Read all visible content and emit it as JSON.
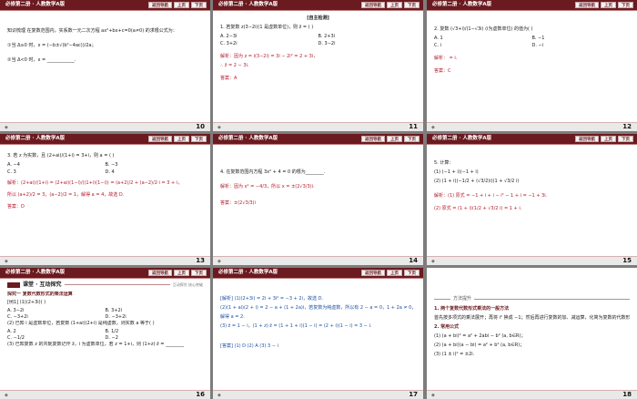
{
  "header": {
    "title": "必修第二册 · 人教数学A版",
    "nav_label": "返回导航",
    "prev_label": "上页",
    "next_label": "下页"
  },
  "slides": [
    {
      "page": "10",
      "lines": [
        "知识梳理 在复数范围内，实系数一元二次方程 ax²+bx+c=0(a≠0) 的求根公式为：",
        "①当 Δ≥0 时，x = (−b±√(b²−4ac))/2a；",
        "②当 Δ<0 时，x = ____________."
      ]
    },
    {
      "page": "11",
      "section": "[自主检测]",
      "lines": [
        "1. 若复数 z(3−2i)(1 是虚数单位)，则 z̄ = (  )",
        "解析：因为 z = i(3−2i) = 3i − 2i² = 2 + 3i，",
        "∴ z̄ = 2 − 3i.",
        "答案：A"
      ],
      "options": [
        "A. 2−3i",
        "B. 2+3i",
        "C. 3+2i",
        "D. 3−2i"
      ]
    },
    {
      "page": "12",
      "lines": [
        "2. 复数 (√3+i)/(1−√3i) (i为虚数单位) 的值为(  )",
        "解析： = i.",
        "答案：C"
      ],
      "options": [
        "A. 1",
        "B. −1",
        "C. i",
        "D. −i"
      ]
    },
    {
      "page": "13",
      "lines": [
        "3. 若 z 为实数，且 (2+ai)/(1+i) = 3+i，则 a = (  )",
        "解析：(2+ai)/(1+i) = (2+ai)(1−i)/((1+i)(1−i)) = (a+2)/2 + (a−2)/2·i = 3 + i，",
        "所以 (a+2)/2 = 3，(a−2)/2 = 1，解得 a = 4，故选 D.",
        "答案：D"
      ],
      "options": [
        "A. −4",
        "B. −3",
        "C. 3",
        "D. 4"
      ]
    },
    {
      "page": "14",
      "lines": [
        "4. 在复数范围内方程 3x² + 4 = 0 的根为________.",
        "解析：因为 x² = −4/3，所以 x = ±(2√3/3)i.",
        "答案：±(2√3/3)i"
      ]
    },
    {
      "page": "15",
      "lines": [
        "5. 计算：",
        "(1) (−1 + i)(−1 + i)",
        "(2) (1 + i)(−1/2 + (√3/2)i)(1 + √3/2 i)",
        "解析：(1) 原式 = −1 + i + i − i² − 1 + i = −1 + 3i.",
        "(2) 原式 = (1 + i)(1/2 + √3/2 i) = 1 + i."
      ]
    },
    {
      "page": "16",
      "banner": "课堂 · 互动探究",
      "banner_tag": "互动探究  核心突破",
      "lines": [
        "探究一  复数代数形式的乘法运算",
        "[例1]  (1)(2+3i)(  )",
        "(2) 已知 i 是虚数单位，若复数 (1+ai)(2+i) 是纯虚数，则实数 a 等于(  )",
        "(3) 已知复数 z 的共轭复数记作 z̄，i 为虚数单位，若 z = 1+i，则 (1+z)·z̄ = ________"
      ],
      "options": [
        "A. 3−2i",
        "B. 3+2i",
        "C. −3+2i",
        "D. −3+2i",
        "A. 2",
        "B. 1/2",
        "C. −1/2",
        "D. −2"
      ]
    },
    {
      "page": "17",
      "lines": [
        "[解析]  (1)(2+3i) = 2i + 3i² = −3 + 2i，故选 D.",
        "(2)(1 + ai)(2 + i) = 2 − a + (1 + 2a)i，若复数为纯虚数，所以有 2 − a = 0，1 + 2a ≠ 0，",
        "解得 a = 2.",
        "(3) z̄ = 1 − i，(1 + z)·z̄ = (1 + 1 + i)(1 − i) = (2 + i)(1 − i) = 3 − i.",
        "[答案]  (1) D  (2) A  (3) 3 − i"
      ]
    },
    {
      "page": "18",
      "method": "方法提升",
      "lines": [
        "1. 两个复数代数形式乘法的一般方法",
        "首先按多项式的乘法展开；再将 i² 换成 −1；然后再进行复数的加、减运算，化简为复数的代数形式.",
        "2. 常用公式",
        "(1) (a + bi)² = a² + 2abi − b² (a, b∈R)；",
        "(2) (a + bi)(a − bi) = a² + b² (a, b∈R)；",
        "(3) (1 ± i)² = ±2i."
      ]
    }
  ]
}
